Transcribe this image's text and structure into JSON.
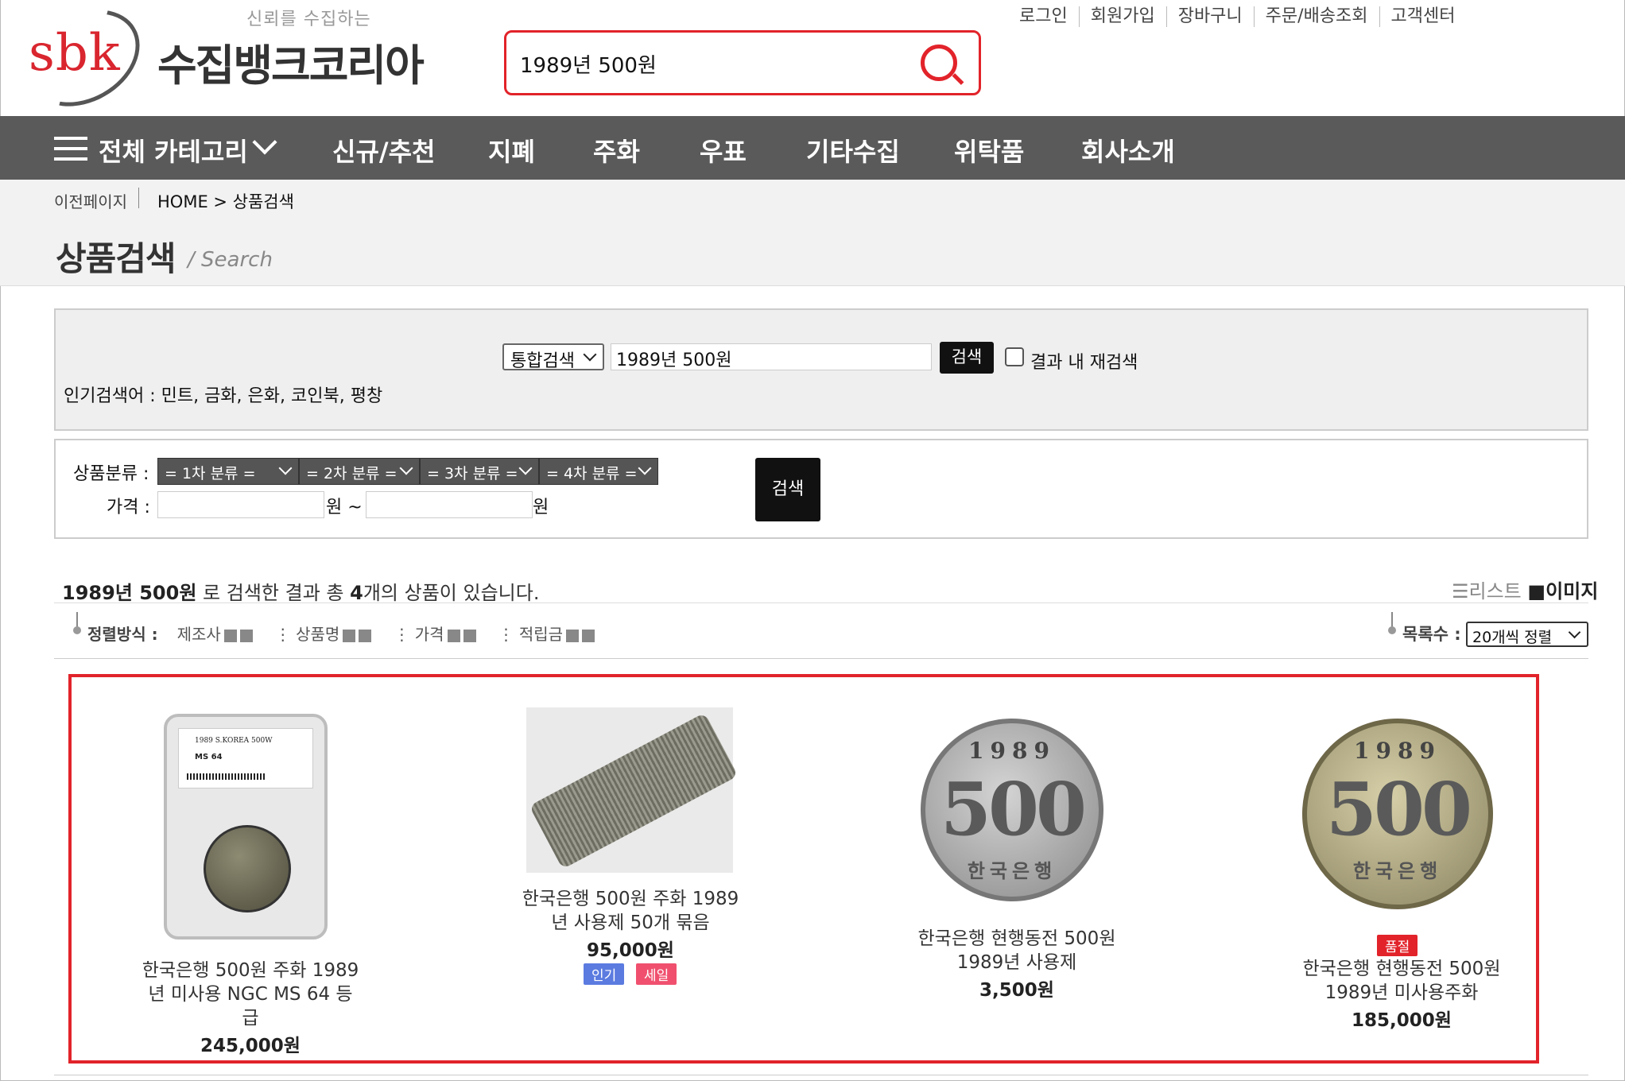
{
  "header": {
    "tagline": "신뢰를 수집하는",
    "logo_en": "sbk",
    "logo_kr": "수집뱅크코리아",
    "search_value": "1989년 500원",
    "top_links": [
      "로그인",
      "회원가입",
      "장바구니",
      "주문/배송조회",
      "고객센터"
    ]
  },
  "nav": {
    "all_categories": "전체 카테고리",
    "items": [
      "신규/추천",
      "지폐",
      "주화",
      "우표",
      "기타수집",
      "위탁품",
      "회사소개"
    ]
  },
  "breadcrumb": {
    "prev": "이전페이지",
    "path": "HOME > 상품검색"
  },
  "page": {
    "title": "상품검색",
    "subtitle": "/  Search"
  },
  "search_panel": {
    "scope": "통합검색",
    "query": "1989년 500원",
    "button": "검색",
    "research_label": "결과 내 재검색",
    "popular": "인기검색어 : 민트, 금화, 은화, 코인북, 평창"
  },
  "filter_panel": {
    "category_label": "상품분류 :",
    "price_label": "가격 :",
    "categories": [
      "= 1차 분류 =",
      "= 2차 분류 =",
      "= 3차 분류 =",
      "= 4차 분류 ="
    ],
    "won": "원",
    "won_tilde": "원 ~",
    "button": "검색"
  },
  "results": {
    "keyword": "1989년 500원",
    "text1": " 로 검색한 결과 총 ",
    "count": "4",
    "text2": "개의 상품이 있습니다.",
    "view_list": "☰리스트",
    "view_image": "■이미지",
    "sort_label": "정렬방식 :",
    "sort_items": [
      "제조사",
      "상품명",
      "가격",
      "적립금"
    ],
    "count_label": "목록수 :",
    "count_select": "20개씩 정렬"
  },
  "products": [
    {
      "name_l1": "한국은행 500원 주화 1989",
      "name_l2": "년 미사용 NGC MS 64 등",
      "name_l3": "급",
      "price": "245,000원",
      "slab_text": "1989 S.KOREA 500W",
      "slab_grade": "MS 64"
    },
    {
      "name_l1": "한국은행 500원 주화 1989",
      "name_l2": "년 사용제 50개 묶음",
      "price": "95,000원",
      "badges": [
        "인기",
        "세일"
      ]
    },
    {
      "name_l1": "한국은행 현행동전 500원",
      "name_l2": "1989년 사용제",
      "price": "3,500원",
      "coin_year": "1989",
      "coin_val": "500",
      "coin_bank": "한국은행"
    },
    {
      "status": "품절",
      "name_l1": "한국은행 현행동전 500원",
      "name_l2": "1989년 미사용주화",
      "price": "185,000원",
      "coin_year": "1989",
      "coin_val": "500",
      "coin_bank": "한국은행"
    }
  ],
  "colors": {
    "accent_red": "#e2232a",
    "nav_bg": "#5a5a5a",
    "badge_blue": "#5b7be0",
    "badge_red": "#f0506e"
  }
}
